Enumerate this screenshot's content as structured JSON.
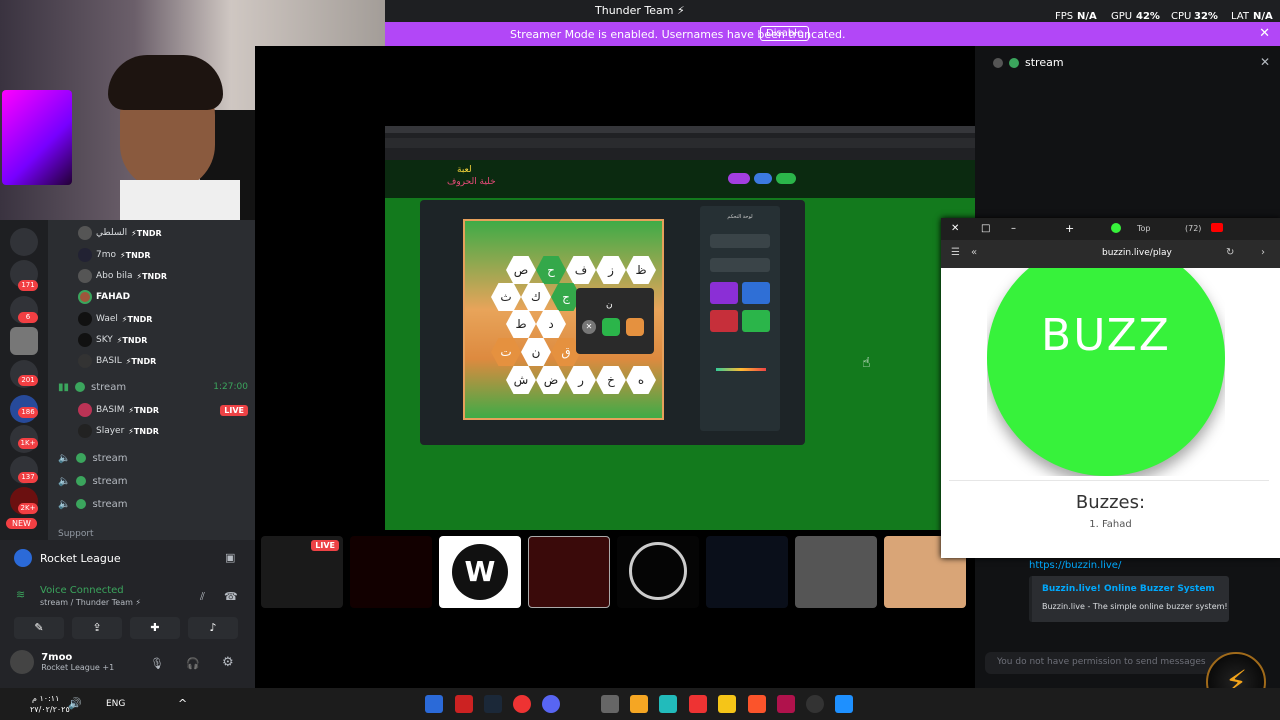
{
  "topbar": {
    "title": "Thunder Team ⚡",
    "fps_label": "FPS",
    "fps_value": "N/A",
    "gpu_label": "GPU",
    "gpu_value": "42%",
    "cpu_label": "CPU",
    "cpu_value": "32%",
    "lat_label": "LAT",
    "lat_value": "N/A"
  },
  "banner": {
    "text": "Streamer Mode is enabled. Usernames have been truncated.",
    "button": "Disable"
  },
  "voice_users": [
    {
      "name": "السلطي",
      "tag": "⚡TNDR"
    },
    {
      "name": "7mo",
      "tag": "⚡TNDR"
    },
    {
      "name": "Abo bila",
      "tag": "⚡TNDR"
    },
    {
      "name": "FAHAD",
      "tag": ""
    },
    {
      "name": "Wael",
      "tag": "⚡TNDR"
    },
    {
      "name": "SKY",
      "tag": "⚡TNDR"
    },
    {
      "name": "BASIL",
      "tag": "⚡TNDR"
    }
  ],
  "stream_channel": {
    "name": "stream",
    "time": "1:27:00"
  },
  "stream_users": [
    {
      "name": "BASIM",
      "tag": "⚡TNDR",
      "badge": "LIVE"
    },
    {
      "name": "Slayer",
      "tag": "⚡TNDR"
    }
  ],
  "other_streams": [
    "stream",
    "stream",
    "stream"
  ],
  "server_badges": [
    "171",
    "6",
    "201",
    "186",
    "1K+",
    "137",
    "2K+"
  ],
  "new_badge": "NEW",
  "support": "Support",
  "rocket_league": "Rocket League",
  "voice_connected": "Voice Connected",
  "voice_sub": "stream / Thunder Team ⚡",
  "user": {
    "name": "7moo",
    "status": "Rocket League +1"
  },
  "game": {
    "logo_top": "لعبة",
    "logo_bottom": "خلية الحروف",
    "board_letters": [
      "ص",
      "ح",
      "ف",
      "ز",
      "ظ",
      "ث",
      "ك",
      "ج",
      "ط",
      "د",
      "ت",
      "ن",
      "ق",
      "ش",
      "ض",
      "ر",
      "خ",
      "ه"
    ],
    "popup_letter": "ن",
    "panel_title": "لوحة التحكم"
  },
  "thumb_live": "LIVE",
  "chat": {
    "title": "stream",
    "link": "https://buzzin.live/",
    "embed_title": "Buzzin.live! Online Buzzer System",
    "embed_desc": "Buzzin.live - The simple online buzzer system!",
    "no_permission": "You do not have permission to send messages"
  },
  "buzz": {
    "url": "buzzin.live/play",
    "tab_count": "(72)",
    "tab_top": "Top",
    "button": "BUZZ",
    "buzzes_title": "Buzzes:",
    "list": [
      "1. Fahad"
    ]
  },
  "taskbar": {
    "lang": "ENG",
    "time": "١٠:١١ م",
    "date": "٢٧/٠٢/٢٠٢٥"
  }
}
